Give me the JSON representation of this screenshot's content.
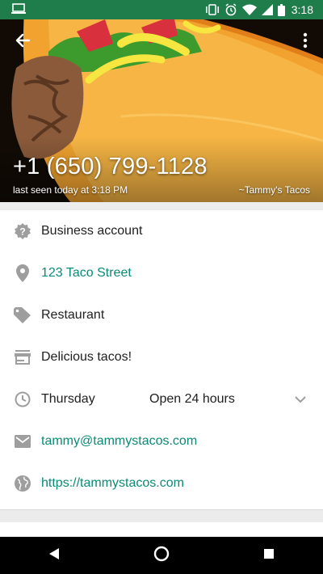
{
  "status_bar": {
    "time": "3:18",
    "icons": [
      "laptop-icon",
      "vibrate-icon",
      "alarm-icon",
      "wifi-icon",
      "signal-icon",
      "battery-icon"
    ]
  },
  "header": {
    "phone_number": "+1 (650) 799-1128",
    "last_seen": "last seen today at 3:18 PM",
    "push_name": "~Tammy's Tacos",
    "icons": [
      "back-arrow-icon",
      "more-vert-icon"
    ]
  },
  "business_info": {
    "account_type": "Business account",
    "address": "123 Taco Street",
    "category": "Restaurant",
    "description": "Delicious tacos!",
    "hours_day": "Thursday",
    "hours_value": "Open 24 hours",
    "email": "tammy@tammystacos.com",
    "website": "https://tammystacos.com"
  },
  "colors": {
    "status_bar": "#1e7d4a",
    "link": "#0b8a76",
    "icon_gray": "#9e9e9e",
    "divider": "#ededed"
  },
  "nav_bar": {
    "icons": [
      "back-triangle-icon",
      "home-circle-icon",
      "recents-square-icon"
    ]
  }
}
